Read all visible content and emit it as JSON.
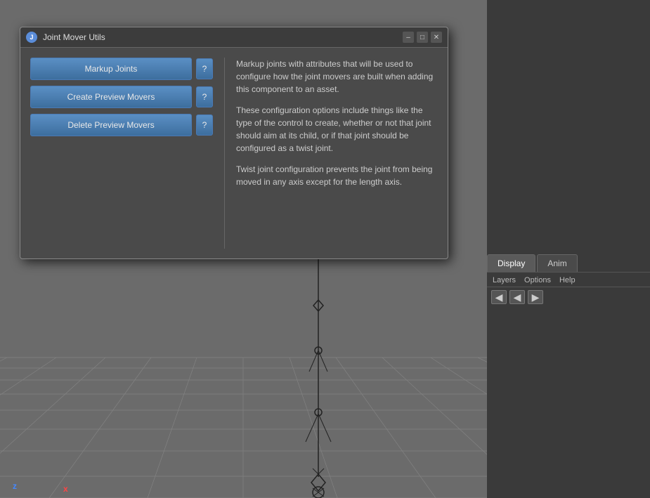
{
  "dialog": {
    "title": "Joint Mover Utils",
    "icon_label": "J",
    "buttons": [
      {
        "id": "markup-joints",
        "label": "Markup Joints"
      },
      {
        "id": "create-preview-movers",
        "label": "Create Preview Movers"
      },
      {
        "id": "delete-preview-movers",
        "label": "Delete Preview Movers"
      }
    ],
    "help_label": "?",
    "info": {
      "para1": "Markup joints with attributes that will be used to configure how the joint movers are built when adding this component to an asset.",
      "para2": "These configuration options include things like the type of the control to create, whether or not that joint should aim at its child, or if that joint should be configured as a twist joint.",
      "para3": "Twist joint configuration prevents the joint from being moved in any axis except for the length axis."
    }
  },
  "win_controls": {
    "minimize": "–",
    "maximize": "□",
    "close": "✕"
  },
  "right_panel": {
    "tabs": [
      {
        "id": "display",
        "label": "Display"
      },
      {
        "id": "anim",
        "label": "Anim"
      }
    ],
    "subtabs": [
      {
        "id": "layers",
        "label": "Layers"
      },
      {
        "id": "options",
        "label": "Options"
      },
      {
        "id": "help",
        "label": "Help"
      }
    ],
    "icons": [
      {
        "id": "icon1",
        "symbol": "◀"
      },
      {
        "id": "icon2",
        "symbol": "◀"
      },
      {
        "id": "icon3",
        "symbol": "▶"
      }
    ]
  },
  "axes": {
    "z": "z",
    "x": "x"
  }
}
